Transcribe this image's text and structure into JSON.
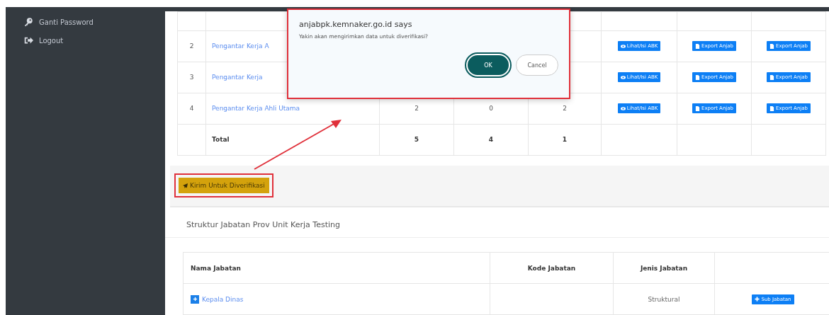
{
  "sidebar": {
    "items": [
      {
        "label": "Ganti Password",
        "kind": "key"
      },
      {
        "label": "Logout",
        "kind": "logout"
      }
    ]
  },
  "table": {
    "rows": [
      {
        "no": "2",
        "name": "Pengantar Kerja A",
        "counts": [],
        "actions": [
          {
            "label": "Lihat/Isi ABK",
            "kind": "view"
          },
          {
            "label": "Export Anjab",
            "kind": "export"
          },
          {
            "label": "Export Anjab",
            "kind": "export"
          }
        ]
      },
      {
        "no": "3",
        "name": "Pengantar Kerja",
        "counts": [],
        "actions": [
          {
            "label": "Lihat/Isi ABK",
            "kind": "view"
          },
          {
            "label": "Export Anjab",
            "kind": "export"
          },
          {
            "label": "Export Anjab",
            "kind": "export"
          }
        ]
      },
      {
        "no": "4",
        "name": "Pengantar Kerja Ahli Utama",
        "counts": [
          "2",
          "0",
          "2"
        ],
        "actions": [
          {
            "label": "Lihat/Isi ABK",
            "kind": "view"
          },
          {
            "label": "Export Anjab",
            "kind": "export"
          },
          {
            "label": "Export Anjab",
            "kind": "export"
          }
        ]
      }
    ],
    "total": {
      "label": "Total",
      "counts": [
        "5",
        "4",
        "1"
      ]
    }
  },
  "submit_button": {
    "label": "Kirim Untuk Diverifikasi",
    "highlighted": true
  },
  "structure": {
    "title": "Struktur Jabatan Prov Unit Kerja Testing",
    "columns": [
      "Nama Jabatan",
      "Kode Jabatan",
      "Jenis Jabatan"
    ],
    "rows": [
      {
        "name": "Kepala Dinas",
        "type": "Struktural",
        "action": "Sub Jabatan"
      }
    ]
  },
  "dialog": {
    "title": "anjabpk.kemnaker.go.id says",
    "message": "Yakin akan mengirimkan data untuk diverifikasi?",
    "highlighted": true,
    "buttons": [
      {
        "label": "OK",
        "kind": "primary"
      },
      {
        "label": "Cancel",
        "kind": "secondary"
      }
    ]
  }
}
